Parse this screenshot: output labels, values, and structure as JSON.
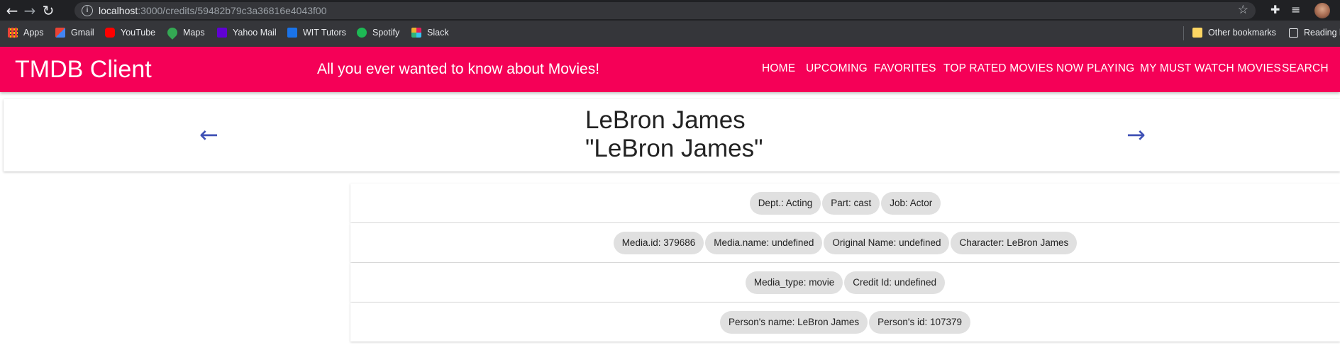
{
  "browser": {
    "url_host": "localhost",
    "url_path": ":3000/credits/59482b79c3a36816e4043f00",
    "bookmarks": [
      "Apps",
      "Gmail",
      "YouTube",
      "Maps",
      "Yahoo Mail",
      "WIT Tutors",
      "Spotify",
      "Slack"
    ],
    "other_bookmarks": "Other bookmarks",
    "reading_list": "Reading l"
  },
  "header": {
    "title": "TMDB Client",
    "tagline": "All you ever wanted to know about Movies!",
    "menu": [
      "HOME",
      "UPCOMING",
      "FAVORITES",
      "TOP RATED MOVIES",
      "NOW PLAYING",
      "MY MUST WATCH MOVIES",
      "SEARCH"
    ]
  },
  "person": {
    "name": "LeBron James",
    "character_quoted": "\"LeBron James\""
  },
  "panels": [
    [
      "Dept.: Acting",
      "Part: cast",
      "Job: Actor"
    ],
    [
      "Media.id: 379686",
      "Media.name: undefined",
      "Original Name: undefined",
      "Character: LeBron James"
    ],
    [
      "Media_type: movie",
      "Credit Id: undefined"
    ],
    [
      "Person's name: LeBron James",
      "Person's id: 107379"
    ]
  ],
  "colors": {
    "accent": "#f50057",
    "arrow": "#3f51b5"
  }
}
